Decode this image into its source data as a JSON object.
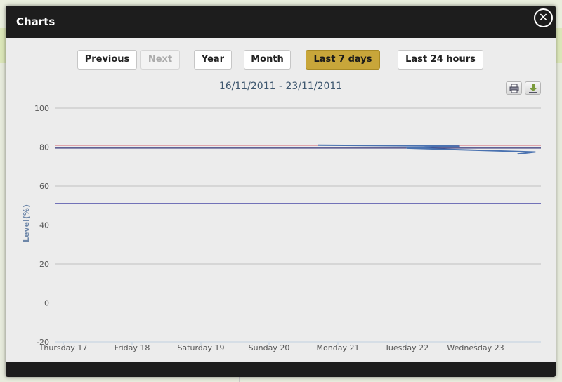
{
  "modal": {
    "title": "Charts"
  },
  "nav": {
    "previous": "Previous",
    "next": "Next",
    "year": "Year",
    "month": "Month",
    "last7": "Last 7 days",
    "last24": "Last 24 hours"
  },
  "chart_data": {
    "type": "line",
    "title": "16/11/2011 - 23/11/2011",
    "ylabel": "Level(%)",
    "xlabel": "",
    "ylim": [
      -20,
      100
    ],
    "yticks": [
      100,
      80,
      60,
      40,
      20,
      0,
      -20
    ],
    "x_tick_labels": [
      "Thursday 17",
      "Friday 18",
      "Saturday 19",
      "Sunday 20",
      "Monday 21",
      "Tuesday 22",
      "Wednesday 23"
    ],
    "grid": true,
    "legend": "none",
    "reference_lines": [
      {
        "y": 81,
        "color": "#cc3344"
      },
      {
        "y": 79.5,
        "color": "#333377"
      },
      {
        "y": 51,
        "color": "#2a2a99"
      }
    ],
    "series": [
      {
        "color": "#4a72b0",
        "points": [
          [
            "Monday 21",
            81
          ],
          [
            "Tuesday 22",
            80.5
          ],
          [
            "Tuesday 22",
            79.5
          ],
          [
            "Wednesday 23",
            77.5
          ],
          [
            "Wednesday 23",
            76.5
          ]
        ]
      }
    ]
  },
  "icons": {
    "close": "close-icon",
    "print": "print-icon",
    "download": "download-icon"
  }
}
